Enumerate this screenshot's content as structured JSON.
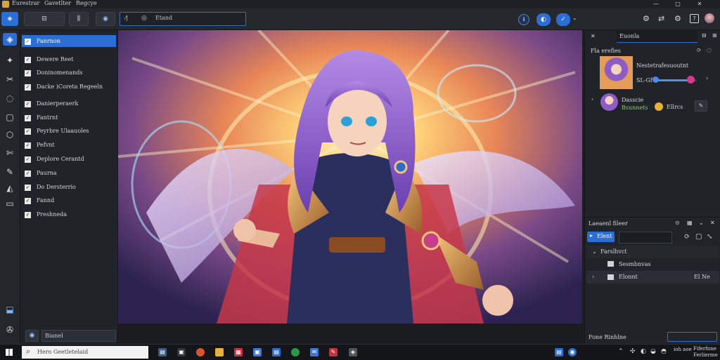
{
  "window": {
    "menu": [
      "Eurestrar",
      "Gavetlter",
      "Regcye"
    ],
    "controls": [
      "—",
      "□",
      "✕"
    ]
  },
  "toolbar": {
    "search_placeholder": "Etand",
    "search_prefix_icons": [
      "⁄|",
      "◎"
    ],
    "left_buttons": [
      "⊟",
      "⫼"
    ],
    "right_icons": [
      "⚙",
      "⇄",
      "⚙"
    ]
  },
  "rail": {
    "icons": [
      "layers-icon",
      "magic-icon",
      "crop-icon",
      "lasso-icon",
      "frame-icon",
      "shape-icon",
      "scissors-icon",
      "brush-icon",
      "fill-icon",
      "stamp-icon"
    ],
    "glyphs": [
      "◈",
      "✦",
      "✂",
      "◌",
      "▢",
      "⬡",
      "✄",
      "✎",
      "◭",
      "▭"
    ],
    "bottom_glyphs": [
      "⬓",
      "✇"
    ]
  },
  "left_panel": {
    "items": [
      {
        "label": "Fanrnon",
        "selected": true
      },
      {
        "label": "Dewere Reet",
        "selected": false
      },
      {
        "label": "Doninomenands",
        "selected": false
      },
      {
        "label": "Dacke )Coreta Regeeln",
        "selected": false
      },
      {
        "label": "Danierperaerk",
        "selected": false
      },
      {
        "label": "Fantrnt",
        "selected": false
      },
      {
        "label": "Peyrbre Ulaauoles",
        "selected": false
      },
      {
        "label": "Pefvnt",
        "selected": false
      },
      {
        "label": "Deplore Cerantd",
        "selected": false
      },
      {
        "label": "Paurna",
        "selected": false
      },
      {
        "label": "Do Dersterrio",
        "selected": false
      },
      {
        "label": "Fannd",
        "selected": false
      },
      {
        "label": "Preshneda",
        "selected": false
      }
    ],
    "footer_value": "Bianel"
  },
  "right_panel": {
    "search_value": "Euonla",
    "section_label": "Fla erefies",
    "layers": [
      {
        "name": "Nestetrafesuoutnt",
        "sub": "SL-Gf"
      },
      {
        "name": "Dasscie",
        "sub": "Bsunnets",
        "tag": "Ellrcs"
      }
    ],
    "slider_level": 0.85,
    "properties_title": "Laeaenl fileer",
    "btn_label": "Elent",
    "field_value": "",
    "tree": [
      {
        "label": "Farslhvct",
        "indent": 0
      },
      {
        "label": "Sesmbnvas",
        "indent": 1
      },
      {
        "label": "Elonnt",
        "indent": 1,
        "suffix": "El Ne"
      }
    ],
    "status": "Fone Rinhlne"
  },
  "taskbar": {
    "search_placeholder": "Hero Geetletelaid",
    "tray_text": [
      "ioh aoe",
      "Fiferfnne",
      "Ferlierme"
    ]
  },
  "colors": {
    "accent": "#2b6fd6",
    "panel": "#202328",
    "toolbar": "#25282d"
  }
}
